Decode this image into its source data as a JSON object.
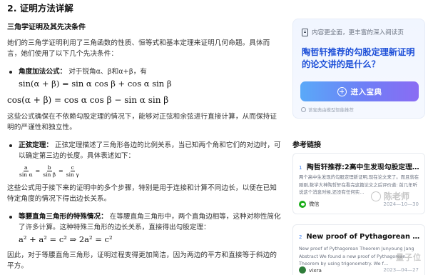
{
  "article": {
    "section_title": "2. 证明方法详解",
    "subsection_title": "三角学证明及其先决条件",
    "intro": "她们的三角学证明利用了三角函数的性质、恒等式和基本定理来证明几何命题。具体而言，她们使用了以下几个先决条件：",
    "bullet1": {
      "title": "角度加法公式：",
      "text": "对于锐角α、β和α+β，有",
      "formula": "sin(α + β) = sin α cos β + cos α sin β"
    },
    "formula_cos": "cos(α + β) = cos α cos β − sin α sin β",
    "para2": "这些公式确保在不依赖勾股定理的情况下，能够对正弦和余弦进行直接计算，从而保持证明的严谨性和独立性。",
    "bullet2": {
      "title": "正弦定理：",
      "text": "正弦定理描述了三角形各边的比例关系，当已知两个角和它们的对边时，可以确定第三边的长度。具体表述如下：",
      "fractions": [
        {
          "num": "a",
          "den": "sin α"
        },
        {
          "num": "b",
          "den": "sin β"
        },
        {
          "num": "c",
          "den": "sin γ"
        }
      ],
      "equals": "="
    },
    "para3": "这些公式用于接下来的证明中的多个步骤，特别是用于连接和计算不同边长，以便在已知特定角度的情况下得出边长关系。",
    "bullet3": {
      "title": "等腰直角三角形的特殊情况：",
      "text": "在等腰直角三角形中，两个直角边相等，这种对称性简化了许多计算。这种特殊三角形的边长关系，直接得出勾股定理：",
      "formula": "a² + a² = c² ⇒ 2a² = c²"
    },
    "para4": "因此，对于等腰直角三角形，证明过程变得更加简洁，因为两边的平方和直接等于斜边的平方。"
  },
  "side": {
    "ad": {
      "header": "内容更全面，更丰富的深入阅读页",
      "question": "陶哲轩推荐的勾股定理新证明的论文讲的是什么？",
      "button_label": "进入宝典",
      "footer": "该宝典由模型智能推荐"
    },
    "refs_title": "参考链接",
    "refs": [
      {
        "num": "1",
        "title": "陶哲轩推荐:2高中生发现勾股定理…",
        "excerpt": "两个高中生发现的勾股定理新证明,现在论文来了。而且就在刚刚,数学大神陶哲轩在看完这篇论文之后评价道: 前几年听说这个消息时候,还没有任何实…",
        "source": "微信",
        "date": "2024—10—30"
      },
      {
        "num": "2",
        "title": "New proof of Pythagorean Theorem…",
        "excerpt": "New proof of Pythagorean Theorem Junyoung Jang Abstract We found a new proof of Pythagorean Theorem by using trigonometry. We f…",
        "source": "vixra",
        "date": "2023—04—27"
      }
    ]
  },
  "watermarks": {
    "top": "陈老师",
    "bottom": "量子位"
  },
  "colors": {
    "accent": "#1d4fd8",
    "button_gradient_start": "#5aa9f8",
    "button_gradient_end": "#8a6cf3",
    "wechat_green": "#1aad19"
  }
}
